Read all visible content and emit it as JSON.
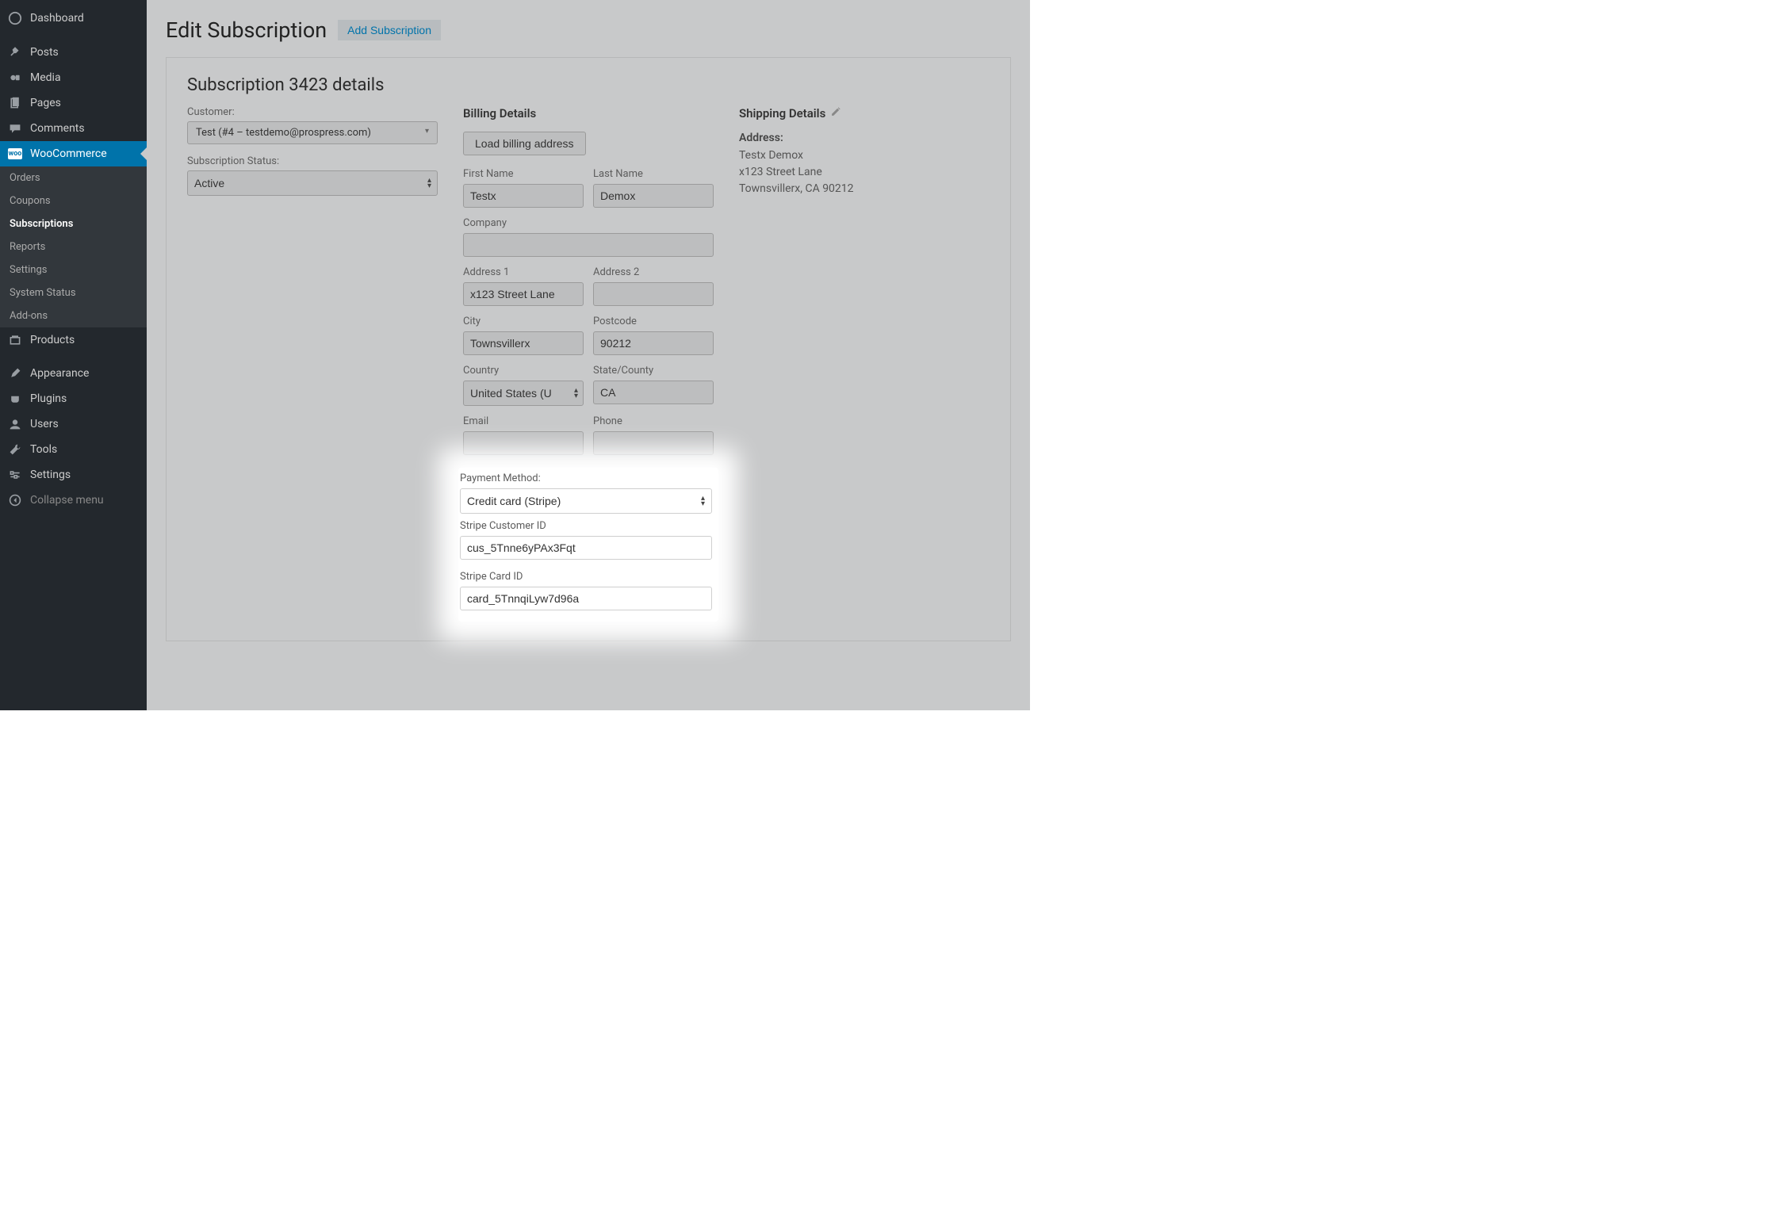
{
  "sidebar": {
    "items": [
      {
        "label": "Dashboard",
        "icon": "⌬"
      },
      {
        "label": "Posts",
        "icon": "📌"
      },
      {
        "label": "Media",
        "icon": "🎛"
      },
      {
        "label": "Pages",
        "icon": "▤"
      },
      {
        "label": "Comments",
        "icon": "💬"
      },
      {
        "label": "WooCommerce",
        "icon": "woo",
        "active": true
      },
      {
        "label": "Products",
        "icon": "🛒"
      },
      {
        "label": "Appearance",
        "icon": "🖌"
      },
      {
        "label": "Plugins",
        "icon": "🔌"
      },
      {
        "label": "Users",
        "icon": "👤"
      },
      {
        "label": "Tools",
        "icon": "🔧"
      },
      {
        "label": "Settings",
        "icon": "⚙"
      },
      {
        "label": "Collapse menu",
        "icon": "◀"
      }
    ],
    "sub": [
      {
        "label": "Orders"
      },
      {
        "label": "Coupons"
      },
      {
        "label": "Subscriptions",
        "current": true
      },
      {
        "label": "Reports"
      },
      {
        "label": "Settings"
      },
      {
        "label": "System Status"
      },
      {
        "label": "Add-ons"
      }
    ]
  },
  "page": {
    "title": "Edit Subscription",
    "add_btn": "Add Subscription"
  },
  "panel": {
    "title": "Subscription 3423 details",
    "customer_label": "Customer:",
    "customer_value": "Test (#4 – testdemo@prospress.com)",
    "status_label": "Subscription Status:",
    "status_value": "Active"
  },
  "billing": {
    "heading": "Billing Details",
    "load_btn": "Load billing address",
    "first_name_label": "First Name",
    "first_name": "Testx",
    "last_name_label": "Last Name",
    "last_name": "Demox",
    "company_label": "Company",
    "company": "",
    "address1_label": "Address 1",
    "address1": "x123 Street Lane",
    "address2_label": "Address 2",
    "address2": "",
    "city_label": "City",
    "city": "Townsvillerx",
    "postcode_label": "Postcode",
    "postcode": "90212",
    "country_label": "Country",
    "country": "United States (U",
    "state_label": "State/County",
    "state": "CA",
    "email_label": "Email",
    "email": "",
    "phone_label": "Phone",
    "phone": ""
  },
  "payment": {
    "method_label": "Payment Method:",
    "method_value": "Credit card (Stripe)",
    "cust_id_label": "Stripe Customer ID",
    "cust_id": "cus_5Tnne6yPAx3Fqt",
    "card_id_label": "Stripe Card ID",
    "card_id": "card_5TnnqiLyw7d96a"
  },
  "shipping": {
    "heading": "Shipping Details",
    "address_label": "Address:",
    "line1": "Testx Demox",
    "line2": "x123 Street Lane",
    "line3": "Townsvillerx, CA 90212"
  }
}
